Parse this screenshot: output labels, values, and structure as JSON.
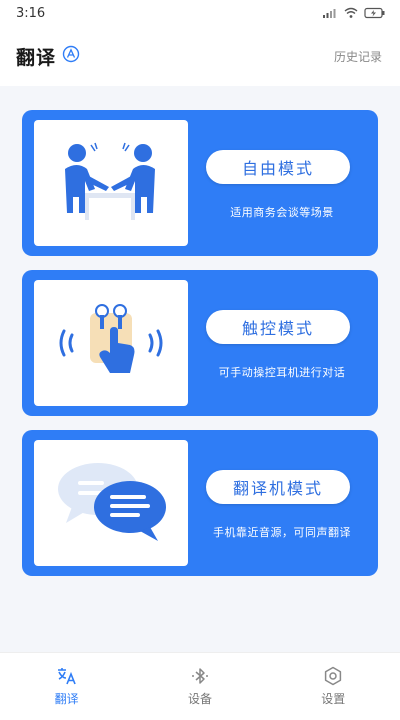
{
  "status_bar": {
    "time": "3:16"
  },
  "header": {
    "title": "翻译",
    "history_label": "历史记录"
  },
  "modes": [
    {
      "button_label": "自由模式",
      "description": "适用商务会谈等场景",
      "icon": "people-talking-icon"
    },
    {
      "button_label": "触控模式",
      "description": "可手动操控耳机进行对话",
      "icon": "touch-earbuds-icon"
    },
    {
      "button_label": "翻译机模式",
      "description": "手机靠近音源，可同声翻译",
      "icon": "chat-bubbles-icon"
    }
  ],
  "bottom_nav": [
    {
      "label": "翻译",
      "icon": "translate-icon",
      "active": true
    },
    {
      "label": "设备",
      "icon": "bluetooth-icon",
      "active": false
    },
    {
      "label": "设置",
      "icon": "settings-icon",
      "active": false
    }
  ],
  "colors": {
    "accent": "#2f7df6",
    "background": "#f4f6fa"
  }
}
